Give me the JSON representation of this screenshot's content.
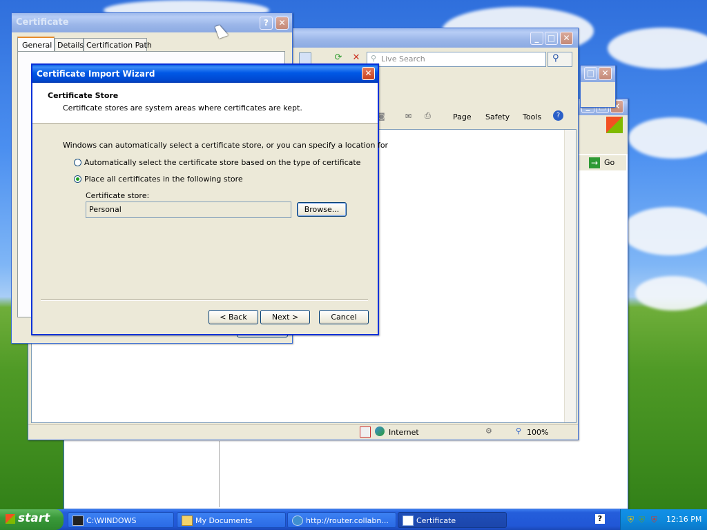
{
  "colors": {
    "accent": "#0054e3",
    "start": "#3a9a3a",
    "taskbar": "#245edb"
  },
  "cert_dialog": {
    "title": "Certificate",
    "tabs": [
      "General",
      "Details",
      "Certification Path"
    ]
  },
  "wizard": {
    "title": "Certificate Import Wizard",
    "heading": "Certificate Store",
    "subheading": "Certificate stores are system areas where certificates are kept.",
    "intro": "Windows can automatically select a certificate store, or you can specify a location for",
    "option_auto": "Automatically select the certificate store based on the type of certificate",
    "option_place": "Place all certificates in the following store",
    "selected_option": "place",
    "store_label": "Certificate store:",
    "store_value": "Personal",
    "browse_label": "Browse...",
    "back_label": "< Back",
    "next_label": "Next >",
    "cancel_label": "Cancel"
  },
  "ie": {
    "search_placeholder": "Live Search",
    "toolbar": {
      "page": "Page",
      "safety": "Safety",
      "tools": "Tools"
    },
    "status_zone": "Internet",
    "zoom": "100%"
  },
  "explorer": {
    "go_label": "Go"
  },
  "taskbar": {
    "start_label": "start",
    "items": [
      {
        "label": "C:\\WINDOWS",
        "icon": "console-icon"
      },
      {
        "label": "My Documents",
        "icon": "folder-icon"
      },
      {
        "label": "http://router.collabn...",
        "icon": "ie-icon"
      },
      {
        "label": "Certificate",
        "icon": "window-icon"
      }
    ],
    "clock": "12:16 PM"
  }
}
